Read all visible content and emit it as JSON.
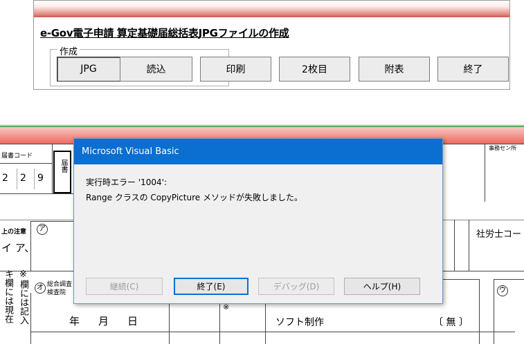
{
  "toolbar": {
    "title": "e-Gov電子申請  算定基礎届総括表JPGファイルの作成",
    "group_label": "作成",
    "buttons": {
      "jpg": "JPG",
      "read": "読込",
      "print": "印刷",
      "second": "2枚目",
      "attach": "附表",
      "exit": "終了"
    }
  },
  "sheet": {
    "code_label": "届書コード",
    "code_digits": [
      "2",
      "2",
      "9"
    ],
    "vertical_label": "届書",
    "note_label": "上の注意",
    "circle_a": "ア",
    "circle_o": "オ",
    "circle_u": "ウ",
    "row_ia": "イ  ア、",
    "side_col1": "キ欄には現在",
    "side_col2": "※欄には記入",
    "comp_label": "総合調査",
    "comp_label2": "検査院",
    "date_label": "年　月　日",
    "mark": "※",
    "software_label": "ソフト制作",
    "software_value": "〔 無 〕",
    "right_label": "社労士コー",
    "office_label": "事務セン所"
  },
  "dialog": {
    "title": "Microsoft Visual Basic",
    "error_title": "実行時エラー '1004':",
    "error_message": "Range クラスの CopyPicture メソッドが失敗しました。",
    "buttons": {
      "continue": "継続(C)",
      "end": "終了(E)",
      "debug": "デバッグ(D)",
      "help": "ヘルプ(H)"
    }
  },
  "colors": {
    "dialog_title_bg": "#0a6fd0",
    "toolbar_bar": "#c85a50",
    "sheet_header": "#ef6a5f"
  }
}
